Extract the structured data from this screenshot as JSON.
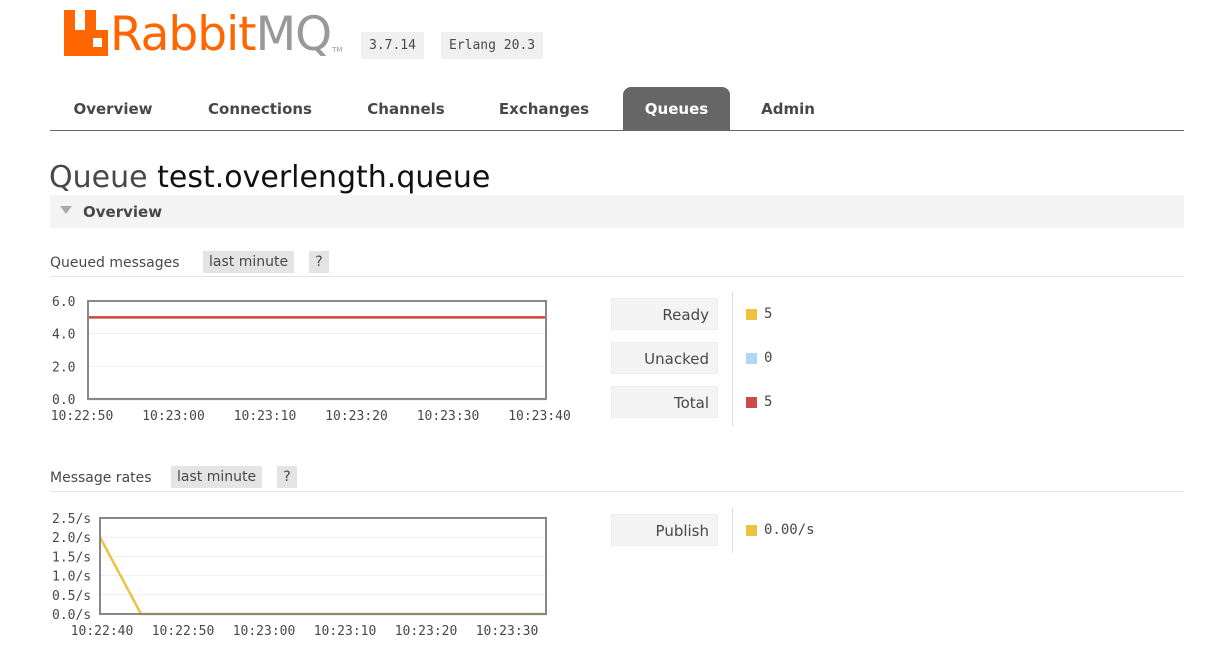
{
  "header": {
    "brand_rabbit": "Rabbit",
    "brand_mq": "MQ",
    "brand_tm": "TM",
    "version": "3.7.14",
    "erlang": "Erlang 20.3",
    "brand_color": "#ff6600"
  },
  "tabs": [
    {
      "label": "Overview",
      "active": false
    },
    {
      "label": "Connections",
      "active": false
    },
    {
      "label": "Channels",
      "active": false
    },
    {
      "label": "Exchanges",
      "active": false
    },
    {
      "label": "Queues",
      "active": true
    },
    {
      "label": "Admin",
      "active": false
    }
  ],
  "page": {
    "title_prefix": "Queue",
    "queue_name": "test.overlength.queue"
  },
  "section": {
    "label": "Overview",
    "icon": "triangle-down-icon"
  },
  "queued_messages": {
    "heading": "Queued messages",
    "range": "last minute",
    "help": "?",
    "legend": [
      {
        "label": "Ready",
        "value": "5",
        "color": "#edc240"
      },
      {
        "label": "Unacked",
        "value": "0",
        "color": "#afd8f8"
      },
      {
        "label": "Total",
        "value": "5",
        "color": "#cb4b4b"
      }
    ]
  },
  "message_rates": {
    "heading": "Message rates",
    "range": "last minute",
    "help": "?",
    "legend": [
      {
        "label": "Publish",
        "value": "0.00/s",
        "color": "#edc240"
      }
    ]
  },
  "chart_data": [
    {
      "type": "line",
      "y_ticks": [
        "6.0",
        "4.0",
        "2.0",
        "0.0"
      ],
      "ylim": [
        0,
        6
      ],
      "x_ticks": [
        "10:22:50",
        "10:23:00",
        "10:23:10",
        "10:23:20",
        "10:23:30",
        "10:23:40"
      ],
      "series": [
        {
          "name": "Ready",
          "color": "#edc240",
          "values": [
            5,
            5
          ]
        },
        {
          "name": "Unacked",
          "color": "#afd8f8",
          "values": [
            0,
            0
          ]
        },
        {
          "name": "Total",
          "color": "#cb4b4b",
          "values": [
            5,
            5
          ]
        }
      ]
    },
    {
      "type": "line",
      "y_ticks": [
        "2.5/s",
        "2.0/s",
        "1.5/s",
        "1.0/s",
        "0.5/s",
        "0.0/s"
      ],
      "ylim": [
        0,
        2.5
      ],
      "x_ticks": [
        "10:22:40",
        "10:22:50",
        "10:23:00",
        "10:23:10",
        "10:23:20",
        "10:23:30"
      ],
      "series": [
        {
          "name": "Publish",
          "color": "#edc240",
          "values": [
            2.0,
            0,
            0,
            0,
            0,
            0,
            0
          ]
        }
      ]
    }
  ]
}
